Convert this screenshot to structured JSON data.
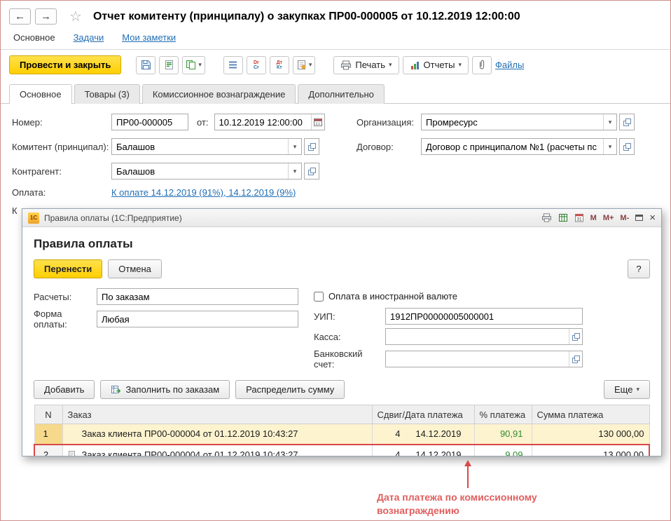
{
  "window": {
    "title": "Отчет комитенту (принципалу) о закупках ПР00-000005 от 10.12.2019 12:00:00",
    "back": "←",
    "forward": "→",
    "star": "☆"
  },
  "nav": {
    "items": [
      {
        "label": "Основное"
      },
      {
        "label": "Задачи"
      },
      {
        "label": "Мои заметки"
      }
    ]
  },
  "toolbar": {
    "post_and_close": "Провести и закрыть",
    "drcr_top": "Dr",
    "drcr_bottom": "Cr",
    "dtkt_top": "Дт",
    "dtkt_bottom": "Кт",
    "print": "Печать",
    "reports": "Отчеты",
    "files": "Файлы",
    "caret": "▾"
  },
  "tabs": [
    {
      "label": "Основное",
      "active": true
    },
    {
      "label": "Товары (3)",
      "active": false
    },
    {
      "label": "Комиссионное вознаграждение",
      "active": false
    },
    {
      "label": "Дополнительно",
      "active": false
    }
  ],
  "form": {
    "number_label": "Номер:",
    "number_value": "ПР00-000005",
    "date_label": "от:",
    "date_value": "10.12.2019 12:00:00",
    "organization_label": "Организация:",
    "organization_value": "Промресурс",
    "principal_label": "Комитент (принципал):",
    "principal_value": "Балашов",
    "contract_label": "Договор:",
    "contract_value": "Договор с принципалом №1 (расчеты пс",
    "counterparty_label": "Контрагент:",
    "counterparty_value": "Балашов",
    "payment_label": "Оплата:",
    "payment_link": "К оплате 14.12.2019 (91%), 14.12.2019 (9%)",
    "clipped_label": "К"
  },
  "dialog": {
    "logo": "1С",
    "title": "Правила оплаты  (1С:Предприятие)",
    "titlebar": {
      "calendar_text": "31",
      "m": "М",
      "m_plus": "М+",
      "m_minus": "М-",
      "close": "×"
    },
    "heading": "Правила оплаты",
    "buttons": {
      "transfer": "Перенести",
      "cancel": "Отмена",
      "help": "?"
    },
    "fields": {
      "calculations_label": "Расчеты:",
      "calculations_value": "По заказам",
      "payment_form_label": "Форма оплаты:",
      "payment_form_value": "Любая",
      "foreign_currency_label": "Оплата в иностранной валюте",
      "uip_label": "УИП:",
      "uip_value": "1912ПР00000005000001",
      "cash_label": "Касса:",
      "cash_value": "",
      "bank_label": "Банковский счет:",
      "bank_value": ""
    },
    "commands": {
      "add": "Добавить",
      "fill_by_orders": "Заполнить по заказам",
      "distribute": "Распределить сумму",
      "more": "Еще"
    },
    "table": {
      "headers": {
        "n": "N",
        "order": "Заказ",
        "shift_date": "Сдвиг/Дата платежа",
        "percent": "% платежа",
        "amount": "Сумма платежа"
      },
      "rows": [
        {
          "n": "1",
          "order": "Заказ клиента ПР00-000004 от 01.12.2019 10:43:27",
          "shift": "4",
          "date": "14.12.2019",
          "percent": "90,91",
          "amount": "130 000,00"
        },
        {
          "n": "2",
          "order": "Заказ клиента ПР00-000004 от 01.12.2019 10:43:27",
          "shift": "4",
          "date": "14.12.2019",
          "percent": "9,09",
          "amount": "13 000,00"
        }
      ]
    }
  },
  "annotation": {
    "text": "Дата платежа по комиссионному вознаграждению"
  },
  "colors": {
    "accent_yellow": "#ffcf00",
    "link_blue": "#216eb5",
    "annotation_red": "#e25d5d",
    "percent_green": "#2e8b2e",
    "selected_row": "#fdf3cf"
  }
}
